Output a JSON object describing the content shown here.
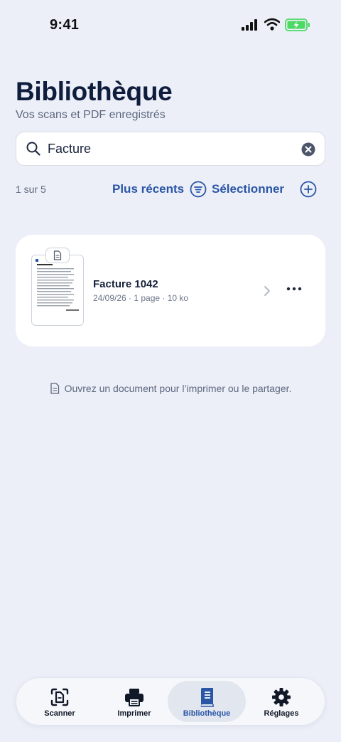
{
  "status_bar": {
    "time": "9:41"
  },
  "header": {
    "title": "Bibliothèque",
    "subtitle": "Vos scans et PDF enregistrés"
  },
  "search": {
    "value": "Facture"
  },
  "toolbar": {
    "count": "1 sur 5",
    "sort_label": "Plus récents",
    "select_label": "Sélectionner"
  },
  "documents": [
    {
      "name": "Facture 1042",
      "meta": "24/09/26 · 1 page · 10 ko",
      "thumbnail_title": "Facture 1042"
    }
  ],
  "hint": {
    "text": "Ouvrez un document pour l’imprimer ou le partager."
  },
  "tabs": [
    {
      "label": "Scanner",
      "icon": "scan-document-icon",
      "active": false
    },
    {
      "label": "Imprimer",
      "icon": "printer-icon",
      "active": false
    },
    {
      "label": "Bibliothèque",
      "icon": "book-icon",
      "active": true
    },
    {
      "label": "Réglages",
      "icon": "gear-icon",
      "active": false
    }
  ],
  "colors": {
    "background": "#eceff8",
    "accent": "#2a56a6",
    "battery": "#4cd964",
    "title": "#0f1d3d"
  }
}
